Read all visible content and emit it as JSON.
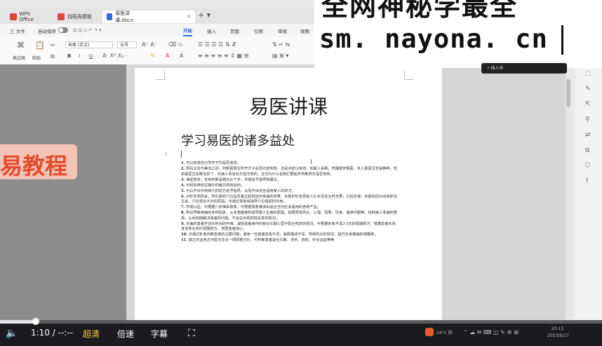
{
  "tabs": [
    {
      "label": "WPS Office",
      "color": "#d9452e"
    },
    {
      "label": "找稻壳模板",
      "color": "#e04a3b"
    },
    {
      "label": "易医讲课.docx",
      "color": "#2b6de0"
    }
  ],
  "menu": {
    "file": "三 文件",
    "autosave": "自动保存",
    "tabs": [
      "开始",
      "插入",
      "页面",
      "引用",
      "审阅",
      "视图"
    ]
  },
  "ribbon": {
    "format_painter": "格式刷",
    "paste": "粘贴",
    "font_name": "宋体 (正文)",
    "font_size": "五号",
    "bold": "B",
    "italic": "I",
    "underline": "U"
  },
  "banner": {
    "line1": "全网神秘学最全",
    "url": "sm. nayona. cn"
  },
  "tooltip": "• 插入中",
  "side_stamp": "易教程",
  "document": {
    "title": "易医讲课",
    "subtitle": "学习易医的诸多益处",
    "items": [
      {
        "n": "1.",
        "text": "可以知道自己所开方剂是否有效。"
      },
      {
        "n": "2.",
        "text": "明白主治与兼治之别，判断医院生所开方子是否对症有效，还是对症以有效，如紧人失眠，吃睡能安眠医，本人虽医生告说精神，但如紧医生失眠治好了，对病人而言此方是无效的。这也为什么说我们要起并判断药方是否有效。"
      },
      {
        "n": "3.",
        "text": "病症复杂，也有判断是路无从下手，并能给予指导和建议。"
      },
      {
        "n": "4.",
        "text": "可轻松辨别古籍中的偏方药效如何。"
      },
      {
        "n": "5.",
        "text": "可以开出中药西方的药方给予指导，从而开出完全适用某人的药方。"
      },
      {
        "n": "6.",
        "text": "对针灸师而言，所扎取的穴位是否真正起到治疗疾病的效果，多数的针灸师给人扎针往往为时无果，过后反弹，实能找回为应有抓住主证，穴位组合不对的原因，可通过易象来指导穴位组成的作用。"
      },
      {
        "n": "7.",
        "text": "学成以后，可根据八卦推来取象，可根据易象推演出适合当代社会适用的各类产品。"
      },
      {
        "n": "8.",
        "text": "明白导致疾病的多种因素，从多角度度判其导致人生病的原因，如居阳宅风水、心理、因果、饮食、鬼神问题等，找到病人发病的根源，从而彻底解决患者的问题，不会在出现药效反复的情况。"
      },
      {
        "n": "9.",
        "text": "无病的患者开且长时间的中西、减轻患者病中的有在长期心里不配合吃药的情况，可根据卦象开具3-5天的短期药方，根据患者实际身体变化实时调整药方，增强患者信心。"
      },
      {
        "n": "10.",
        "text": "可通过卦象判断患者的主要问题，避免一些患者说有不详，病情描述不清，导致判对的情况，提升自身看病的准确率。"
      },
      {
        "n": "11.",
        "text": "真正的运用古中医无非合一阴阳整方针，可判断患者适合丸散、汤剂、药粉、针灸运益等等"
      }
    ]
  },
  "player": {
    "time": "1:10 / --:--",
    "quality": "超清",
    "speed": "倍速",
    "subtitle": "字幕",
    "progress_fraction": 0.06
  },
  "tray": {
    "weather": "24°C 阴",
    "clock": "20:11",
    "date": "2023/9/17"
  }
}
